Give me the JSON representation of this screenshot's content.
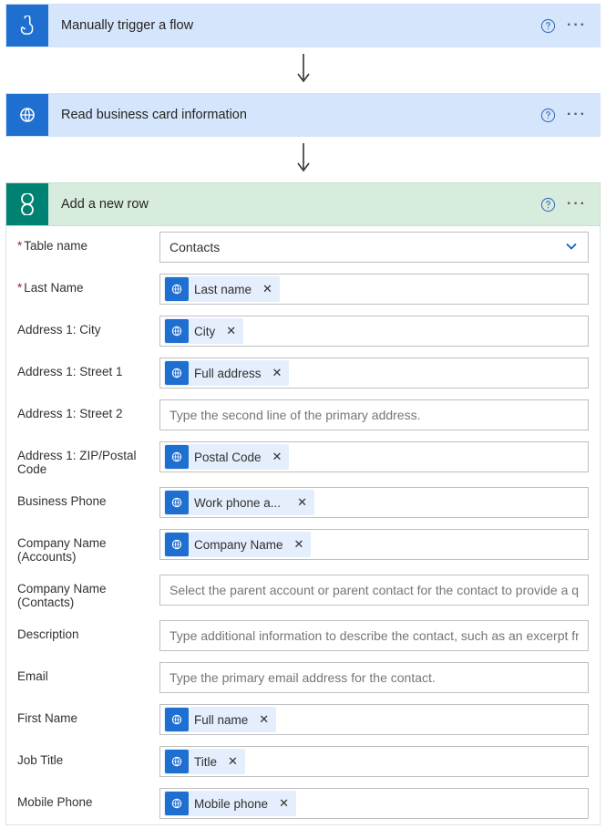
{
  "steps": [
    {
      "title": "Manually trigger a flow"
    },
    {
      "title": "Read business card information"
    },
    {
      "title": "Add a new row"
    }
  ],
  "tableNameLabel": "Table name",
  "tableNameValue": "Contacts",
  "fields": {
    "lastName": {
      "label": "Last Name",
      "token": "Last name"
    },
    "city": {
      "label": "Address 1: City",
      "token": "City"
    },
    "street1": {
      "label": "Address 1: Street 1",
      "token": "Full address"
    },
    "street2": {
      "label": "Address 1: Street 2",
      "placeholder": "Type the second line of the primary address."
    },
    "zip": {
      "label": "Address 1: ZIP/Postal Code",
      "token": "Postal Code"
    },
    "businessPhone": {
      "label": "Business Phone",
      "token": "Work phone a..."
    },
    "companyAccounts": {
      "label": "Company Name (Accounts)",
      "token": "Company Name"
    },
    "companyContacts": {
      "label": "Company Name (Contacts)",
      "placeholder": "Select the parent account or parent contact for the contact to provide a quick li"
    },
    "description": {
      "label": "Description",
      "placeholder": "Type additional information to describe the contact, such as an excerpt from th"
    },
    "email": {
      "label": "Email",
      "placeholder": "Type the primary email address for the contact."
    },
    "firstName": {
      "label": "First Name",
      "token": "Full name"
    },
    "jobTitle": {
      "label": "Job Title",
      "token": "Title"
    },
    "mobilePhone": {
      "label": "Mobile Phone",
      "token": "Mobile phone"
    }
  }
}
